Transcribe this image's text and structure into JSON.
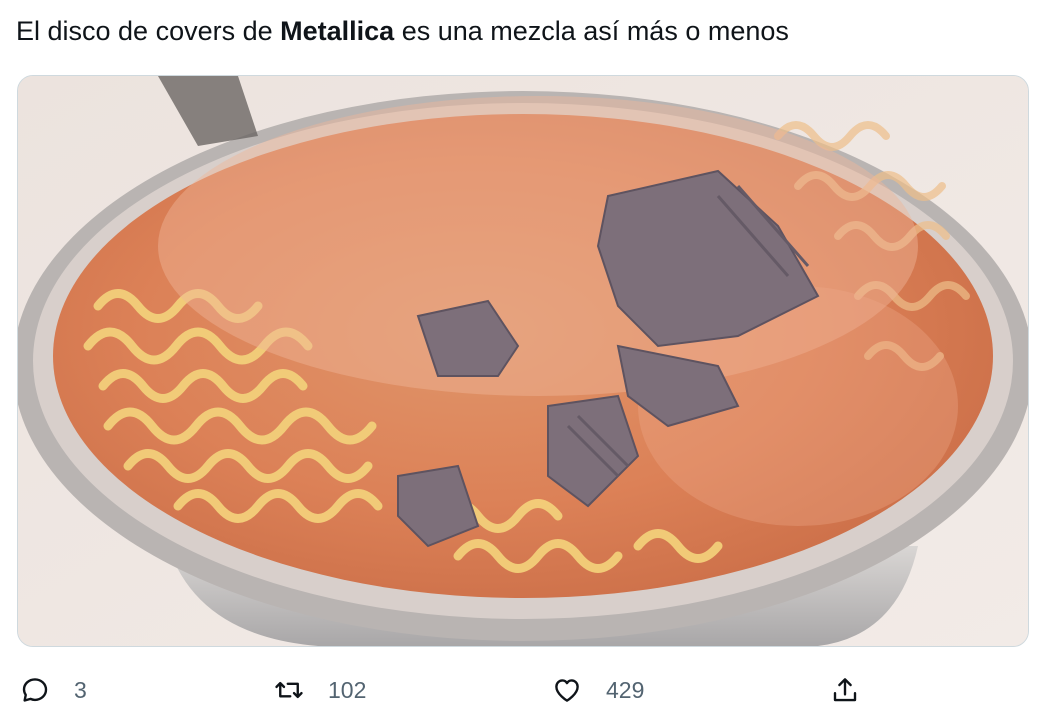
{
  "tweet": {
    "text_before": "El disco de covers de ",
    "text_bold": "Metallica",
    "text_after": " es una mezcla así más o menos"
  },
  "media": {
    "icon": "photo-ramen-pot-with-chocolate"
  },
  "actions": {
    "reply_count": "3",
    "retweet_count": "102",
    "like_count": "429"
  },
  "colors": {
    "text": "#0f1419",
    "secondary": "#536471",
    "border": "#cfd9de"
  }
}
